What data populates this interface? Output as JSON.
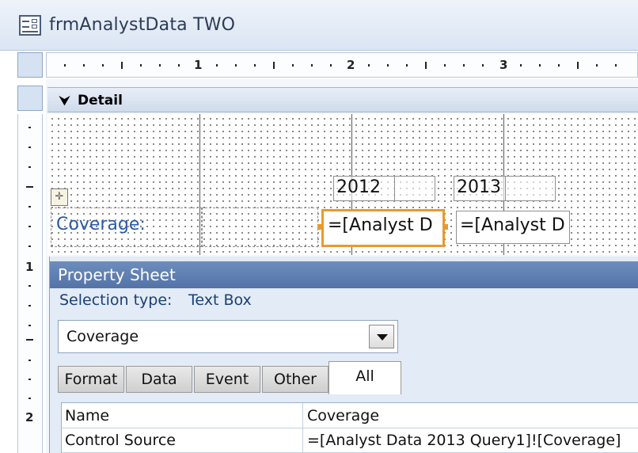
{
  "window": {
    "title": "frmAnalystData TWO"
  },
  "ruler": {
    "horizontal_marks": [
      "1",
      "2",
      "3"
    ],
    "vertical_marks": [
      "1",
      "2"
    ]
  },
  "section": {
    "label": "Detail"
  },
  "form_controls": {
    "label_2012": "2012",
    "label_2013": "2013",
    "coverage_label": "Coverage:",
    "textbox_2012": "=[Analyst D",
    "textbox_2013": "=[Analyst D"
  },
  "property_sheet": {
    "title": "Property Sheet",
    "selection_type_label": "Selection type:",
    "selection_type_value": "Text Box",
    "selected_control": "Coverage",
    "tabs": [
      "Format",
      "Data",
      "Event",
      "Other",
      "All"
    ],
    "active_tab": "All",
    "rows": [
      {
        "name": "Name",
        "value": "Coverage"
      },
      {
        "name": "Control Source",
        "value": "=[Analyst Data 2013 Query1]![Coverage]"
      }
    ]
  },
  "colors": {
    "selection_accent": "#e89a2c",
    "sheet_header": "#5a7ab0",
    "label_text": "#2a5aa8"
  }
}
